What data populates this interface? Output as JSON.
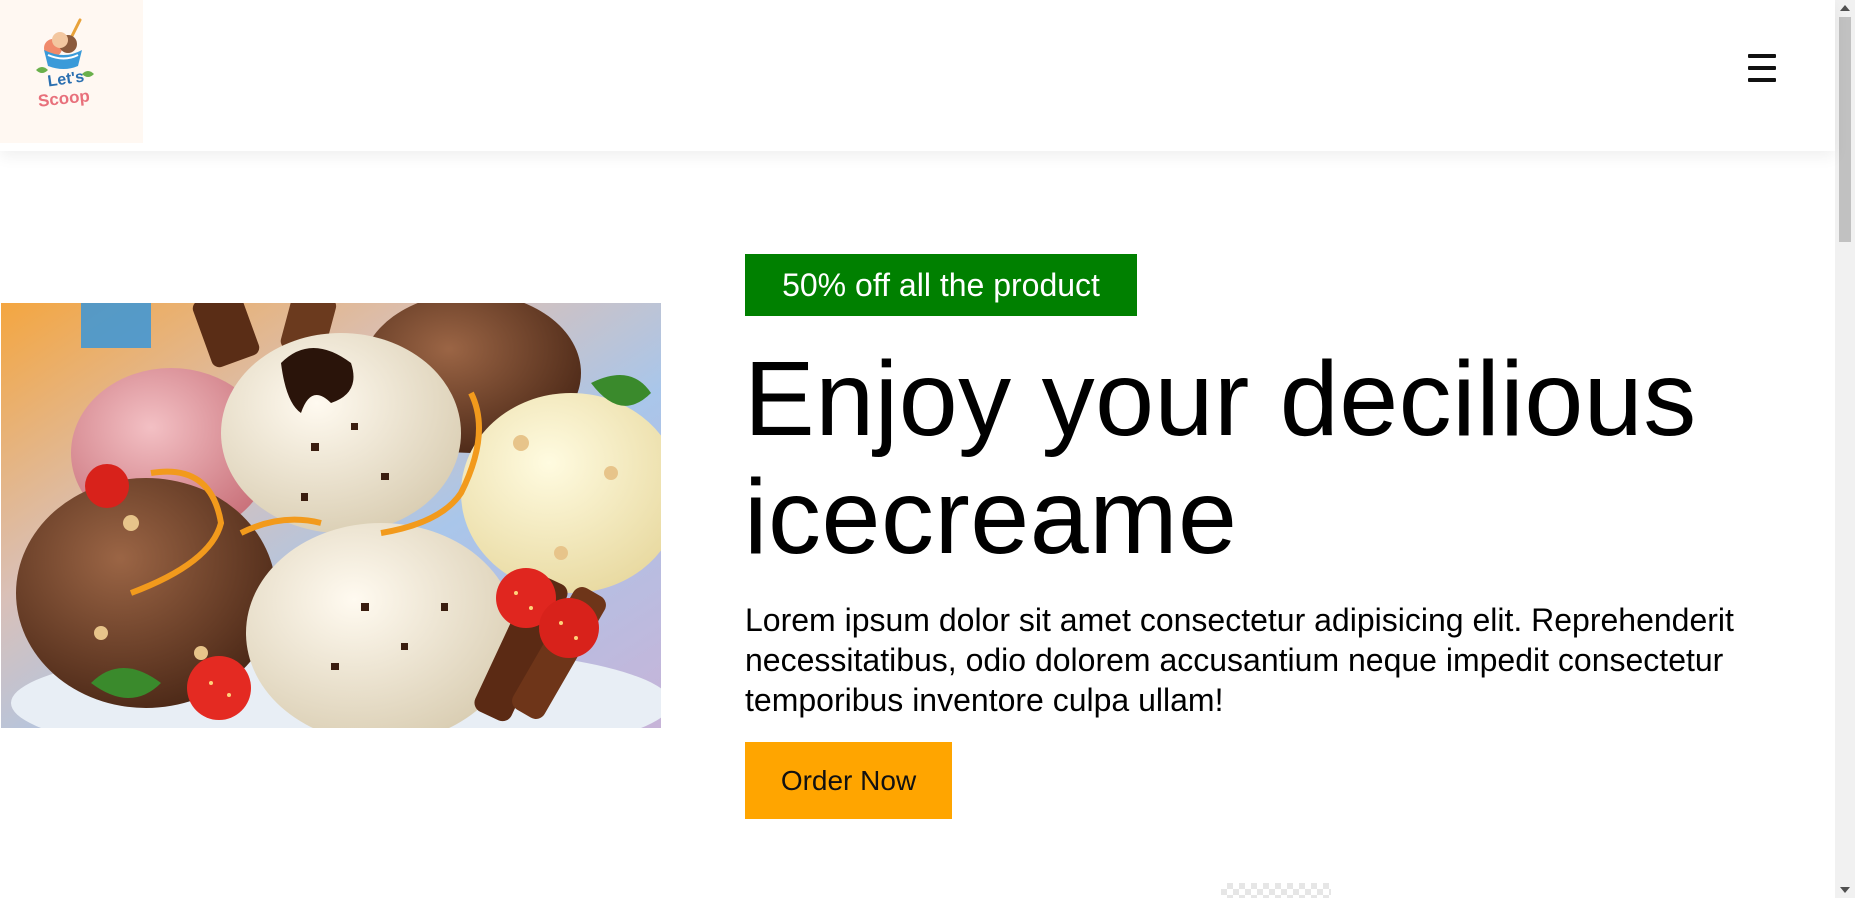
{
  "header": {
    "logo": {
      "line1": "Let's",
      "line2": "Scoop",
      "background": "#fff8f2"
    },
    "menu_icon": "hamburger-menu-icon"
  },
  "hero": {
    "promo_badge": "50% off all the product",
    "title": "Enjoy your decilious icecreame",
    "description": "Lorem ipsum dolor sit amet consectetur adipisicing elit. Reprehenderit necessitatibus, odio dolorem accusantium neque impedit consectetur temporibus inventore culpa ullam!",
    "order_button": "Order Now",
    "image_icon": "ice-cream-scoops-image"
  },
  "colors": {
    "badge_bg": "#008000",
    "button_bg": "#ffa500",
    "text": "#000000"
  }
}
